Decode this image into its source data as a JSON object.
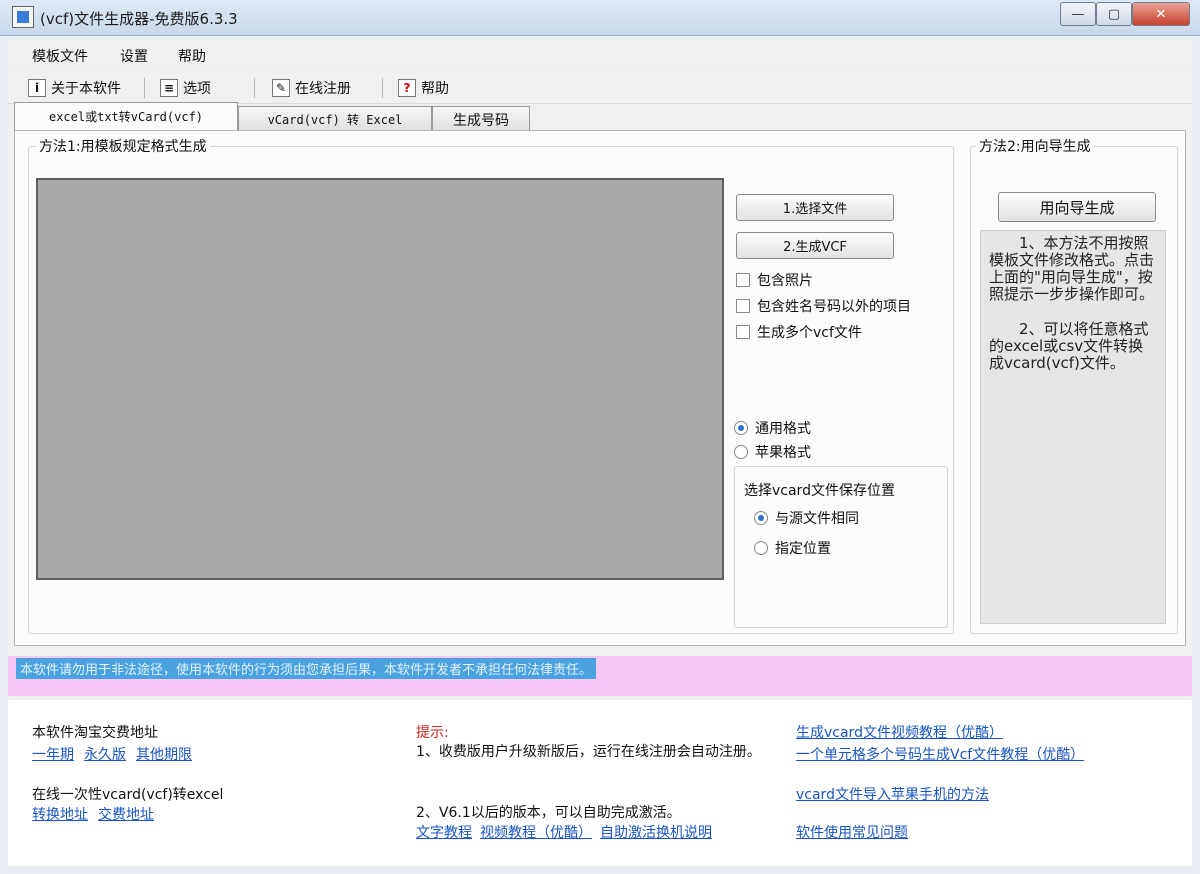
{
  "window": {
    "title": "(vcf)文件生成器-免费版6.3.3",
    "controls": [
      "—",
      "▢",
      "✕"
    ]
  },
  "menu": [
    "模板文件",
    "设置",
    "帮助"
  ],
  "toolbar": [
    {
      "label": "关于本软件",
      "icon": "info-icon"
    },
    {
      "label": "选项",
      "icon": "options-icon"
    },
    {
      "label": "在线注册",
      "icon": "register-icon"
    },
    {
      "label": "帮助",
      "icon": "help-icon",
      "glyph": "?"
    }
  ],
  "tabs": [
    "excel或txt转vCard(vcf)",
    "vCard(vcf) 转 Excel",
    "生成号码"
  ],
  "method1": {
    "title": "方法1:用模板规定格式生成",
    "buttons": {
      "select": "1.选择文件",
      "generate": "2.生成VCF"
    },
    "checkboxes": [
      "包含照片",
      "包含姓名号码以外的项目",
      "生成多个vcf文件"
    ],
    "formats": {
      "general": "通用格式",
      "apple": "苹果格式",
      "selected": "general"
    },
    "save_location": {
      "title": "选择vcard文件保存位置",
      "same": "与源文件相同",
      "custom": "指定位置",
      "selected": "same"
    }
  },
  "method2": {
    "title": "方法2:用向导生成",
    "button": "用向导生成",
    "hint1": "1、本方法不用按照模板文件修改格式。点击上面的\"用向导生成\"，按照提示一步步操作即可。",
    "hint2": "2、可以将任意格式的excel或csv文件转换成vcard(vcf)文件。"
  },
  "notice": "本软件请勿用于非法途径，使用本软件的行为须由您承担后果，本软件开发者不承担任何法律责任。",
  "bottom": {
    "taobao": {
      "label": "本软件淘宝交费地址",
      "links": [
        "一年期",
        "永久版",
        "其他期限"
      ]
    },
    "online": {
      "label": "在线一次性vcard(vcf)转excel",
      "links": [
        "转换地址",
        "交费地址"
      ]
    },
    "tips": {
      "title": "提示:",
      "line1": "1、收费版用户升级新版后，运行在线注册会自动注册。",
      "line2": "2、V6.1以后的版本，可以自助完成激活。",
      "links": [
        "文字教程",
        "视频教程（优酷）",
        "自助激活换机说明"
      ]
    },
    "right_links": [
      "生成vcard文件视频教程（优酷）",
      "一个单元格多个号码生成Vcf文件教程（优酷）",
      "vcard文件导入苹果手机的方法",
      "软件使用常见问题"
    ]
  }
}
